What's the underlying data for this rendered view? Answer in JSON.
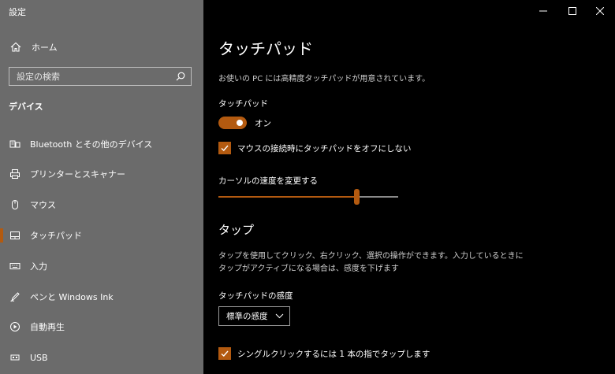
{
  "window": {
    "title": "設定"
  },
  "sidebar": {
    "home_label": "ホーム",
    "search_placeholder": "設定の検索",
    "section_title": "デバイス",
    "items": [
      {
        "label": "Bluetooth とその他のデバイス",
        "icon": "bluetooth-devices-icon"
      },
      {
        "label": "プリンターとスキャナー",
        "icon": "printer-icon"
      },
      {
        "label": "マウス",
        "icon": "mouse-icon"
      },
      {
        "label": "タッチパッド",
        "icon": "touchpad-icon",
        "selected": true
      },
      {
        "label": "入力",
        "icon": "keyboard-icon"
      },
      {
        "label": "ペンと Windows Ink",
        "icon": "pen-icon"
      },
      {
        "label": "自動再生",
        "icon": "autoplay-icon"
      },
      {
        "label": "USB",
        "icon": "usb-icon"
      }
    ]
  },
  "main": {
    "title": "タッチパッド",
    "description": "お使いの PC には高精度タッチパッドが用意されています。",
    "touchpad_label": "タッチパッド",
    "toggle_state": "オン",
    "toggle_on": true,
    "keep_on_with_mouse_label": "マウスの接続時にタッチパッドをオフにしない",
    "keep_on_with_mouse_checked": true,
    "cursor_speed_label": "カーソルの速度を変更する",
    "cursor_speed_value": 0.78,
    "tap_heading": "タップ",
    "tap_description_line1": "タップを使用してクリック、右クリック、選択の操作ができます。入力しているときに",
    "tap_description_line2": "タップがアクティブになる場合は、感度を下げます",
    "sensitivity_label": "タッチパッドの感度",
    "sensitivity_value": "標準の感度",
    "single_tap_label": "シングルクリックするには 1 本の指でタップします",
    "single_tap_checked": true
  },
  "colors": {
    "accent": "#b35a10",
    "sidebar_bg": "#6b6b6b",
    "main_bg": "#000000"
  }
}
